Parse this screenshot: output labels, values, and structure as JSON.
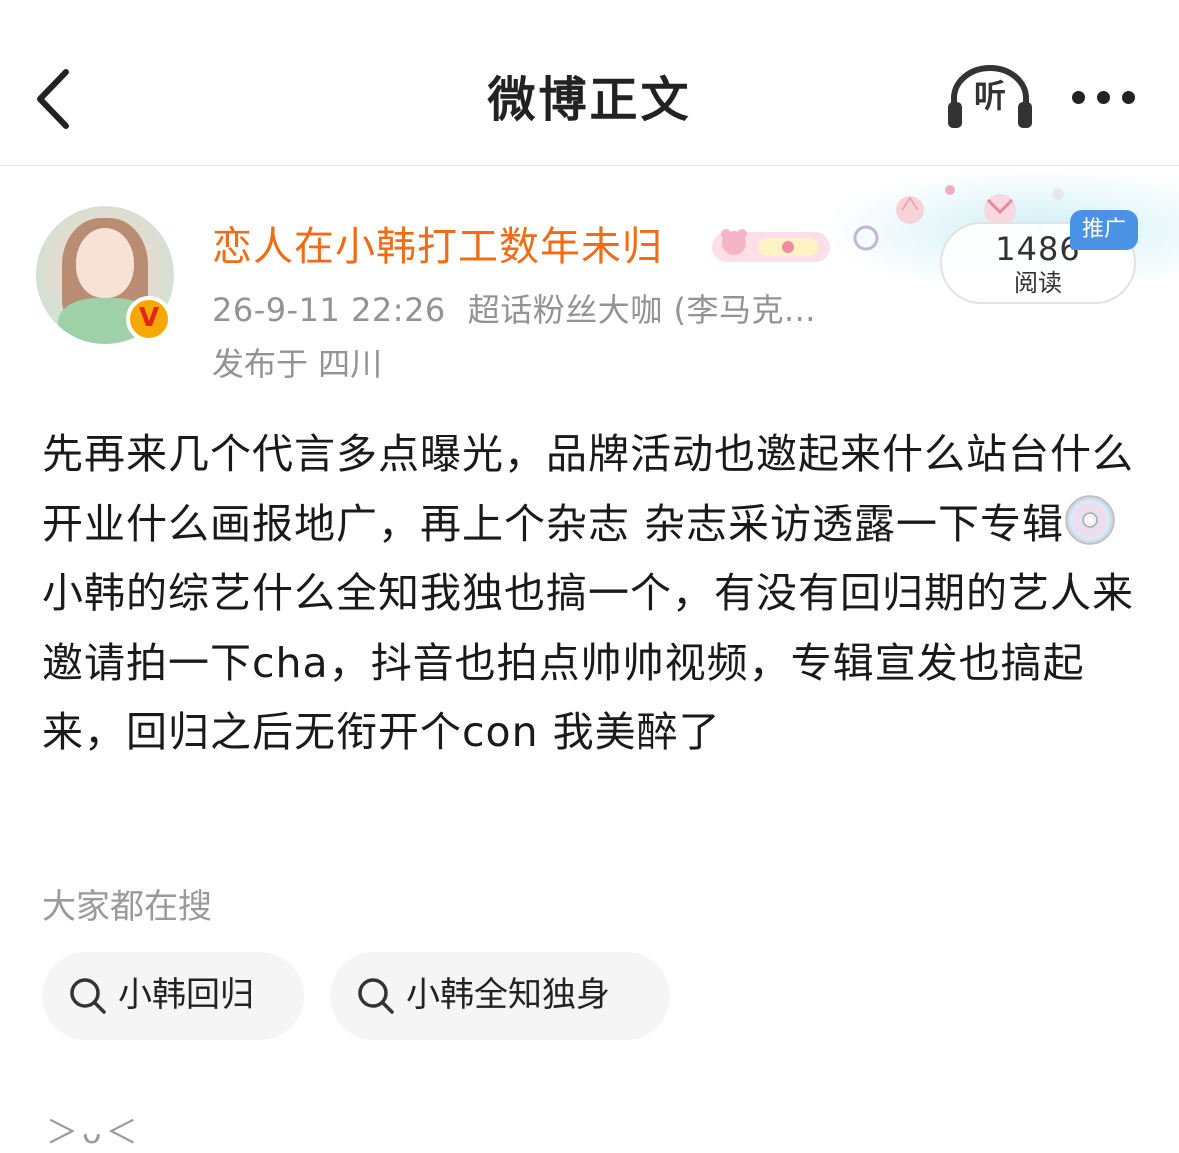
{
  "nav": {
    "title": "微博正文",
    "listen_label": "听",
    "icons": {
      "back": "chevron-left-icon",
      "listen": "headphones-icon",
      "more": "more-dots-icon"
    }
  },
  "author": {
    "name": "恋人在小韩打工数年未归",
    "name_color": "#f46b16",
    "verified_badge": "V",
    "timestamp": "26-9-11 22:26",
    "source": "超话粉丝大咖 (李马克...",
    "location": "发布于 四川"
  },
  "stats": {
    "read_count": "1486",
    "read_label": "阅读",
    "promo_badge": "推广",
    "promo_color": "#4a92e4"
  },
  "post": {
    "text_before_icon": "先再来几个代言多点曝光，品牌活动也邀起来什么站台什么开业什么画报地广，再上个杂志 杂志采访透露一下专辑",
    "inline_icon": "cd-disc-icon",
    "text_after_icon": "小韩的综艺什么全知我独也搞一个，有没有回归期的艺人来邀请拍一下cha，抖音也拍点帅帅视频，专辑宣发也搞起来，回归之后无衔开个con 我美醉了"
  },
  "search": {
    "heading": "大家都在搜",
    "chips": [
      {
        "label": "小韩回归"
      },
      {
        "label": "小韩全知独身"
      }
    ]
  },
  "footer": {
    "emoticon": "＞ᴗ＜"
  }
}
